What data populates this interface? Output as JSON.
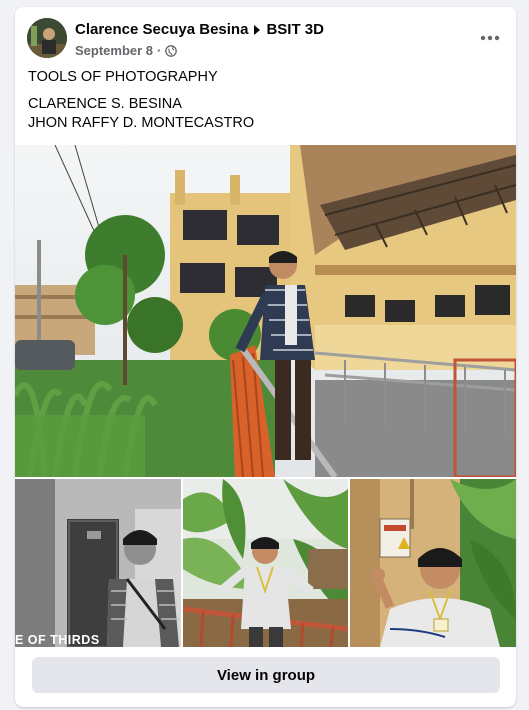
{
  "post": {
    "author": "Clarence Secuya Besina",
    "group": "BSIT 3D",
    "date": "September 8",
    "separator": "·",
    "privacy_icon": "globe-icon",
    "more_icon": "more-horizontal-icon"
  },
  "content": {
    "title": "TOOLS OF PHOTOGRAPHY",
    "names": [
      "CLARENCE S. BESINA",
      "JHON RAFFY D. MONTECASTRO"
    ]
  },
  "photos": {
    "grid_caption": "E OF THIRDS"
  },
  "actions": {
    "view_in_group": "View in group"
  },
  "colors": {
    "card_bg": "#ffffff",
    "page_bg": "#f0f2f5",
    "secondary_text": "#65676b",
    "button_bg": "#e4e6eb"
  }
}
